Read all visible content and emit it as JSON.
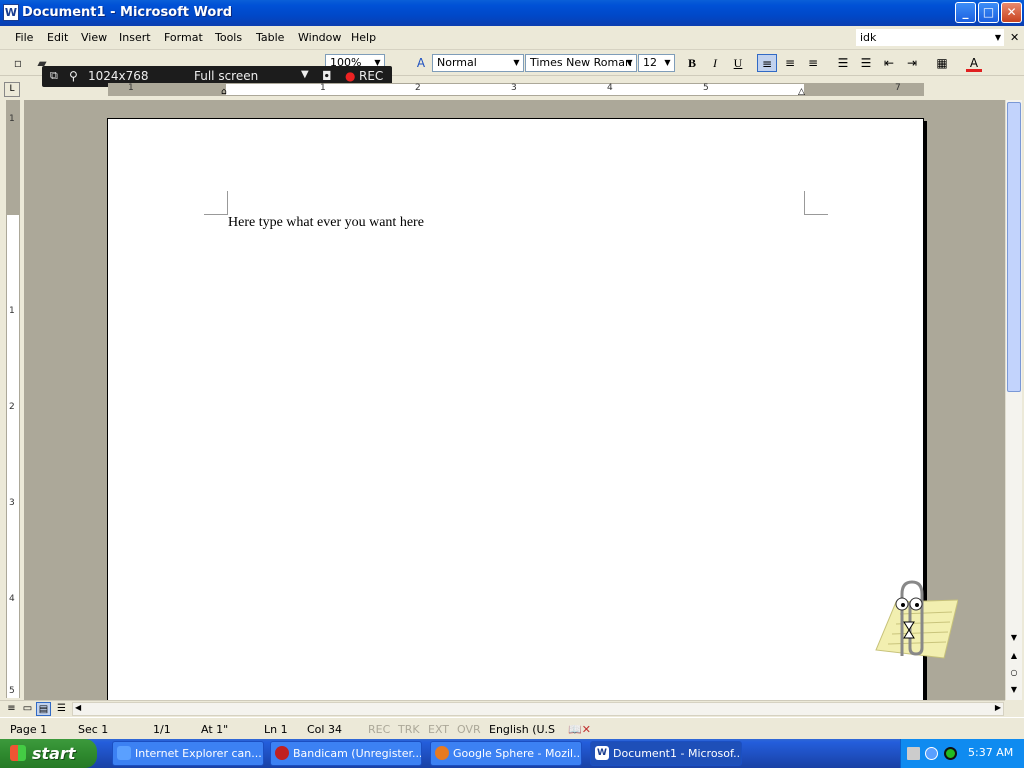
{
  "window": {
    "title": "Document1 - Microsoft Word",
    "app_icon": "W"
  },
  "window_controls": {
    "minimize": "_",
    "maximize": "□",
    "close": "✕"
  },
  "menu": [
    "File",
    "Edit",
    "View",
    "Insert",
    "Format",
    "Tools",
    "Table",
    "Window",
    "Help"
  ],
  "help_box": {
    "value": "idk"
  },
  "toolbar": {
    "zoom": "100%",
    "style": "Normal",
    "font": "Times New Roman",
    "font_size": "12",
    "bold": "B",
    "italic": "I",
    "underline": "U",
    "font_color_label": "A"
  },
  "bandicam": {
    "resolution": "1024x768",
    "mode": "Full screen",
    "rec": "REC"
  },
  "ruler": {
    "h_numbers": [
      "1",
      "1",
      "2",
      "3",
      "4",
      "5",
      "7"
    ],
    "v_numbers": [
      "1",
      "1",
      "2",
      "3",
      "4",
      "5"
    ]
  },
  "document": {
    "text": "Here type what ever you want here"
  },
  "status": {
    "page": "Page  1",
    "sec": "Sec  1",
    "pages": "1/1",
    "at": "At  1\"",
    "ln": "Ln  1",
    "col": "Col  34",
    "rec": "REC",
    "trk": "TRK",
    "ext": "EXT",
    "ovr": "OVR",
    "language": "English (U.S"
  },
  "taskbar": {
    "start": "start",
    "items": [
      "Internet Explorer can...",
      "Bandicam (Unregister...",
      "Google Sphere - Mozil...",
      "Document1 - Microsof..."
    ],
    "clock": "5:37 AM"
  },
  "colors": {
    "titlebar": "#0a5fd8",
    "workspace": "#aca899",
    "font_color_bar": "#e02020",
    "taskbar": "#245edc",
    "start": "#2f8a2f"
  }
}
